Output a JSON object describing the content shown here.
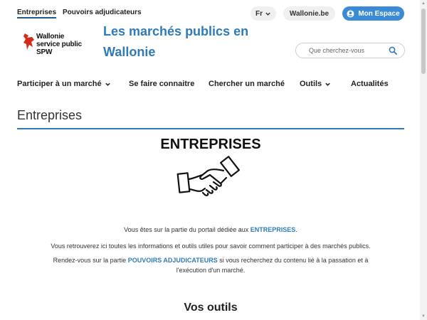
{
  "topbar": {
    "tab_companies": "Entreprises",
    "tab_authorities": "Pouvoirs adjudicateurs",
    "lang": "Fr",
    "wallonie_link": "Wallonie.be",
    "account_button": "Mon Espace"
  },
  "logo": {
    "line1": "Wallonie",
    "line2": "service public",
    "line3": "SPW"
  },
  "site": {
    "title_line1": "Les marchés publics en",
    "title_line2": "Wallonie"
  },
  "search": {
    "placeholder": "Que cherchez-vous"
  },
  "nav": {
    "participate": "Participer à un marché",
    "register": "Se faire connaitre",
    "search_market": "Chercher un marché",
    "tools": "Outils",
    "news": "Actualités"
  },
  "page": {
    "section_title": "Entreprises",
    "hero_title": "ENTREPRISES",
    "p1_before": "Vous êtes sur la partie du portail dédiée aux ",
    "p1_link": "ENTREPRISES",
    "p1_after": ".",
    "p2": "Vous retrouverez ici toutes les informations et outils utiles pour savoir comment participer à des marchés publics.",
    "p3_before": "Rendez-vous sur la partie ",
    "p3_link": "POUVOIRS ADJUDICATEURS",
    "p3_after": " si vous recherchez du contenu lié à la passation et à l'exécution d'un marché.",
    "tools_title": "Vos outils"
  },
  "colors": {
    "accent": "#2f7ab8",
    "button_blue": "#3b8ad6",
    "logo_red": "#d52b1e"
  },
  "icons": {
    "lang": "chevron-down-icon",
    "account": "user-circle-icon",
    "search": "search-icon",
    "hero": "handshake-icon"
  }
}
